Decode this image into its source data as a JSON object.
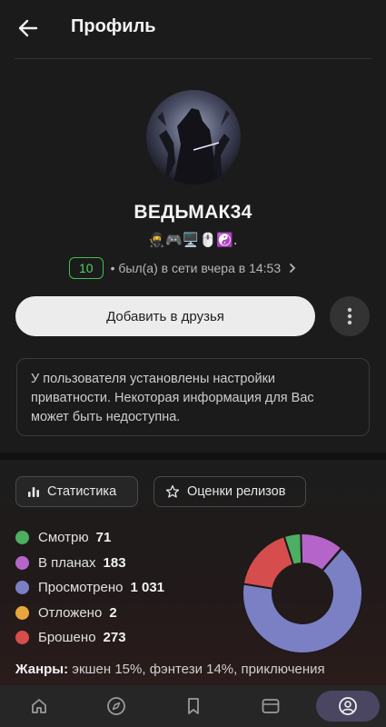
{
  "header": {
    "title": "Профиль"
  },
  "profile": {
    "username": "ВЕДЬМАК34",
    "status_emojis": "🥷🎮🖥️🖱️☯️.",
    "level": "10",
    "online_text": "• был(а) в сети вчера в 14:53",
    "add_friend_label": "Добавить в друзья",
    "privacy_notice": "У пользователя установлены настройки приватности. Некоторая информация для Вас может быть недоступна."
  },
  "tabs": [
    {
      "label": "Статистика",
      "icon": "bar-chart-icon",
      "active": true
    },
    {
      "label": "Оценки релизов",
      "icon": "star-icon",
      "active": false
    }
  ],
  "stats": [
    {
      "label": "Смотрю",
      "count": "71",
      "value": 71,
      "color": "#4caf62"
    },
    {
      "label": "В планах",
      "count": "183",
      "value": 183,
      "color": "#b565c9"
    },
    {
      "label": "Просмотрено",
      "count": "1 031",
      "value": 1031,
      "color": "#7b80c4"
    },
    {
      "label": "Отложено",
      "count": "2",
      "value": 2,
      "color": "#e8a63c"
    },
    {
      "label": "Брошено",
      "count": "273",
      "value": 273,
      "color": "#d64d4d"
    }
  ],
  "genres": {
    "label": "Жанры:",
    "text": "экшен 15%, фэнтези 14%, приключения"
  },
  "nav": [
    {
      "icon": "home-icon",
      "active": false
    },
    {
      "icon": "compass-icon",
      "active": false
    },
    {
      "icon": "bookmark-icon",
      "active": false
    },
    {
      "icon": "calendar-icon",
      "active": false
    },
    {
      "icon": "profile-icon",
      "active": true
    }
  ]
}
